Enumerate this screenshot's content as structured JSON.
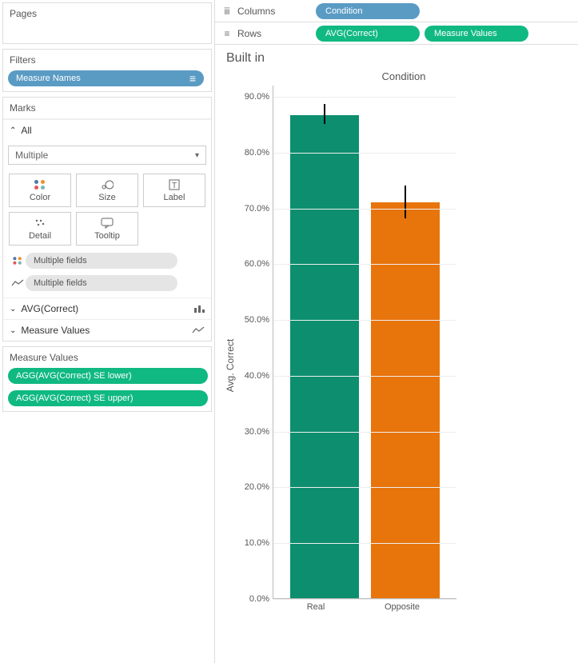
{
  "left": {
    "pages_title": "Pages",
    "filters_title": "Filters",
    "measure_names_pill": "Measure Names",
    "marks_title": "Marks",
    "all_label": "All",
    "dropdown_value": "Multiple",
    "buttons": {
      "color": "Color",
      "size": "Size",
      "label": "Label",
      "detail": "Detail",
      "tooltip": "Tooltip"
    },
    "multiple_fields_1": "Multiple fields",
    "multiple_fields_2": "Multiple fields",
    "avg_correct": "AVG(Correct)",
    "measure_values_label": "Measure Values",
    "measure_values_title": "Measure Values",
    "agg_lower": "AGG(AVG(Correct) SE lower)",
    "agg_upper": "AGG(AVG(Correct) SE upper)"
  },
  "shelves": {
    "columns_label": "Columns",
    "rows_label": "Rows",
    "condition_pill": "Condition",
    "avg_correct_pill": "AVG(Correct)",
    "measure_values_pill": "Measure Values"
  },
  "viz": {
    "title": "Built in",
    "column_header": "Condition",
    "ylabel": "Avg. Correct",
    "xticks": {
      "0": "Real",
      "1": "Opposite"
    },
    "yticks": {
      "0": "0.0%",
      "10": "10.0%",
      "20": "20.0%",
      "30": "30.0%",
      "40": "40.0%",
      "50": "50.0%",
      "60": "60.0%",
      "70": "70.0%",
      "80": "80.0%",
      "90": "90.0%"
    }
  },
  "chart_data": {
    "type": "bar",
    "title": "Built in",
    "xlabel": "Condition",
    "ylabel": "Avg. Correct",
    "categories": [
      "Real",
      "Opposite"
    ],
    "values": [
      86.5,
      71.0
    ],
    "error_lower": [
      85.0,
      68.0
    ],
    "error_upper": [
      88.5,
      74.0
    ],
    "ylim": [
      0,
      92
    ],
    "yticks": [
      0,
      10,
      20,
      30,
      40,
      50,
      60,
      70,
      80,
      90
    ],
    "ytick_format": "percent_one_decimal",
    "colors": {
      "Real": "#0d8f6f",
      "Opposite": "#e8740c"
    }
  }
}
